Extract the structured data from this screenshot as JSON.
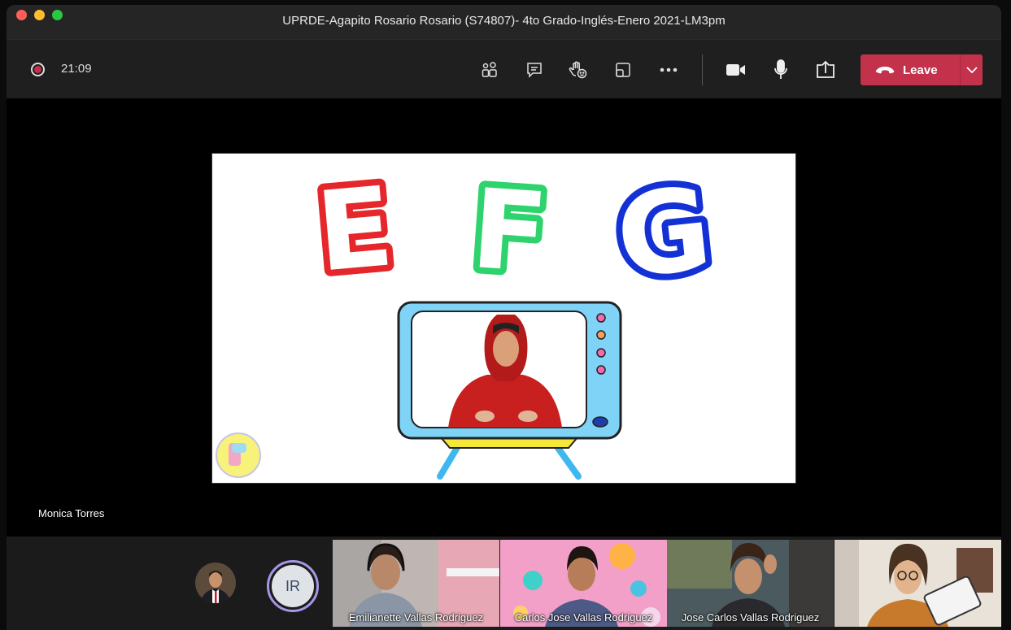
{
  "window": {
    "title": "UPRDE-Agapito Rosario Rosario (S74807)- 4to Grado-Inglés-Enero 2021-LM3pm"
  },
  "toolbar": {
    "timer": "21:09",
    "icons": [
      "participants-icon",
      "chat-icon",
      "raise-hand-icon",
      "rooms-icon",
      "more-icon",
      "camera-icon",
      "mic-icon",
      "share-icon"
    ],
    "leave_label": "Leave"
  },
  "colors": {
    "leave": "#c4314b",
    "letter_e": "#e5262b",
    "letter_f": "#2fd36e",
    "letter_g": "#1431d6",
    "tv_body": "#7fd3f7"
  },
  "stage": {
    "slide_letters": [
      "E",
      "F",
      "G"
    ],
    "presenter_name": "Monica Torres"
  },
  "participants": {
    "initials": "IR",
    "tiles": [
      {
        "name": "Emilianette Vallas Rodriguez"
      },
      {
        "name": "Carlos Jose Vallas Rodriguez"
      },
      {
        "name": "Jose Carlos Vallas Rodriguez"
      }
    ]
  }
}
